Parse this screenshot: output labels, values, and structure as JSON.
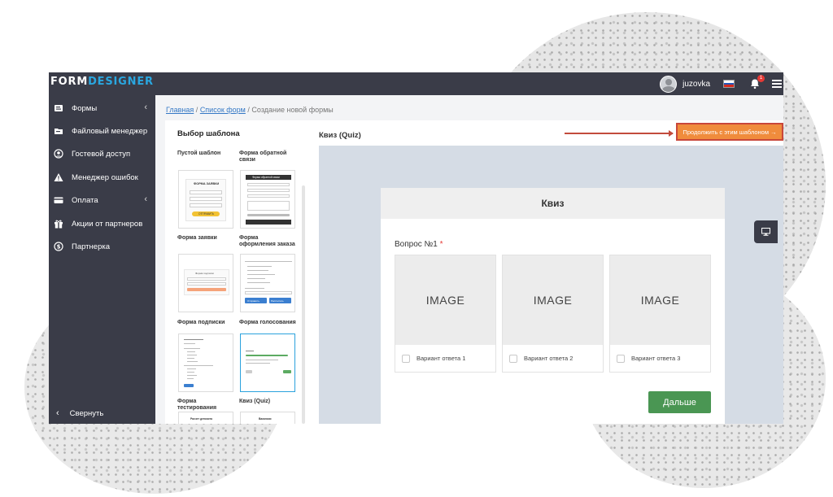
{
  "app": {
    "logo_part1": "FORM",
    "logo_part2": "DESIGNER",
    "username": "juzovka",
    "notification_count": "1"
  },
  "sidebar": {
    "items": [
      {
        "label": "Формы",
        "icon": "forms-icon",
        "has_arrow": true
      },
      {
        "label": "Файловый менеджер",
        "icon": "file-manager-icon",
        "has_arrow": false
      },
      {
        "label": "Гостевой доступ",
        "icon": "guest-access-icon",
        "has_arrow": false
      },
      {
        "label": "Менеджер ошибок",
        "icon": "warning-icon",
        "has_arrow": false
      },
      {
        "label": "Оплата",
        "icon": "credit-card-icon",
        "has_arrow": true
      },
      {
        "label": "Акции от партнеров",
        "icon": "gift-icon",
        "has_arrow": false
      },
      {
        "label": "Партнерка",
        "icon": "dollar-icon",
        "has_arrow": false
      }
    ],
    "collapse_label": "Свернуть",
    "arrow_glyph": "‹"
  },
  "breadcrumb": {
    "home": "Главная",
    "forms_list": "Список форм",
    "current": "Создание новой формы",
    "separator": "/"
  },
  "templates": {
    "title": "Выбор шаблона",
    "items": [
      {
        "label": "Пустой шаблон",
        "thumb_title": "ФОРМА ЗАЯВКИ",
        "thumb_button": "ОТПРАВИТЬ"
      },
      {
        "label": "Форма обратной связи",
        "thumb_title": "Форма обратной связи"
      },
      {
        "label": "Форма заявки",
        "thumb_title": "Форма подписки"
      },
      {
        "label": "Форма оформления заказа",
        "thumb_button1": "Отправить",
        "thumb_button2": "Рассчитать"
      },
      {
        "label": "Форма подписки"
      },
      {
        "label": "Форма голосования",
        "selected": true
      },
      {
        "label": "Форма тестирования",
        "thumb_title": "Расчет депозита"
      },
      {
        "label": "Квиз (Quiz)",
        "thumb_title": "Вакансии"
      }
    ]
  },
  "preview": {
    "title": "Квиз (Quiz)",
    "use_button": "Продолжить с этим шаблоном →",
    "card_title": "Квиз",
    "question_label": "Вопрос №1",
    "required_mark": "*",
    "options": [
      {
        "image": "IMAGE",
        "label": "Вариант ответа 1"
      },
      {
        "image": "IMAGE",
        "label": "Вариант ответа 2"
      },
      {
        "image": "IMAGE",
        "label": "Вариант ответа 3"
      }
    ],
    "next_button": "Дальше"
  },
  "colors": {
    "topbar": "#3a3c48",
    "logo_accent": "#2aa7e0",
    "use_button": "#f08c3c",
    "highlight_border": "#c9473a",
    "next_button": "#4a9653",
    "preview_bg": "#d5dce5"
  }
}
